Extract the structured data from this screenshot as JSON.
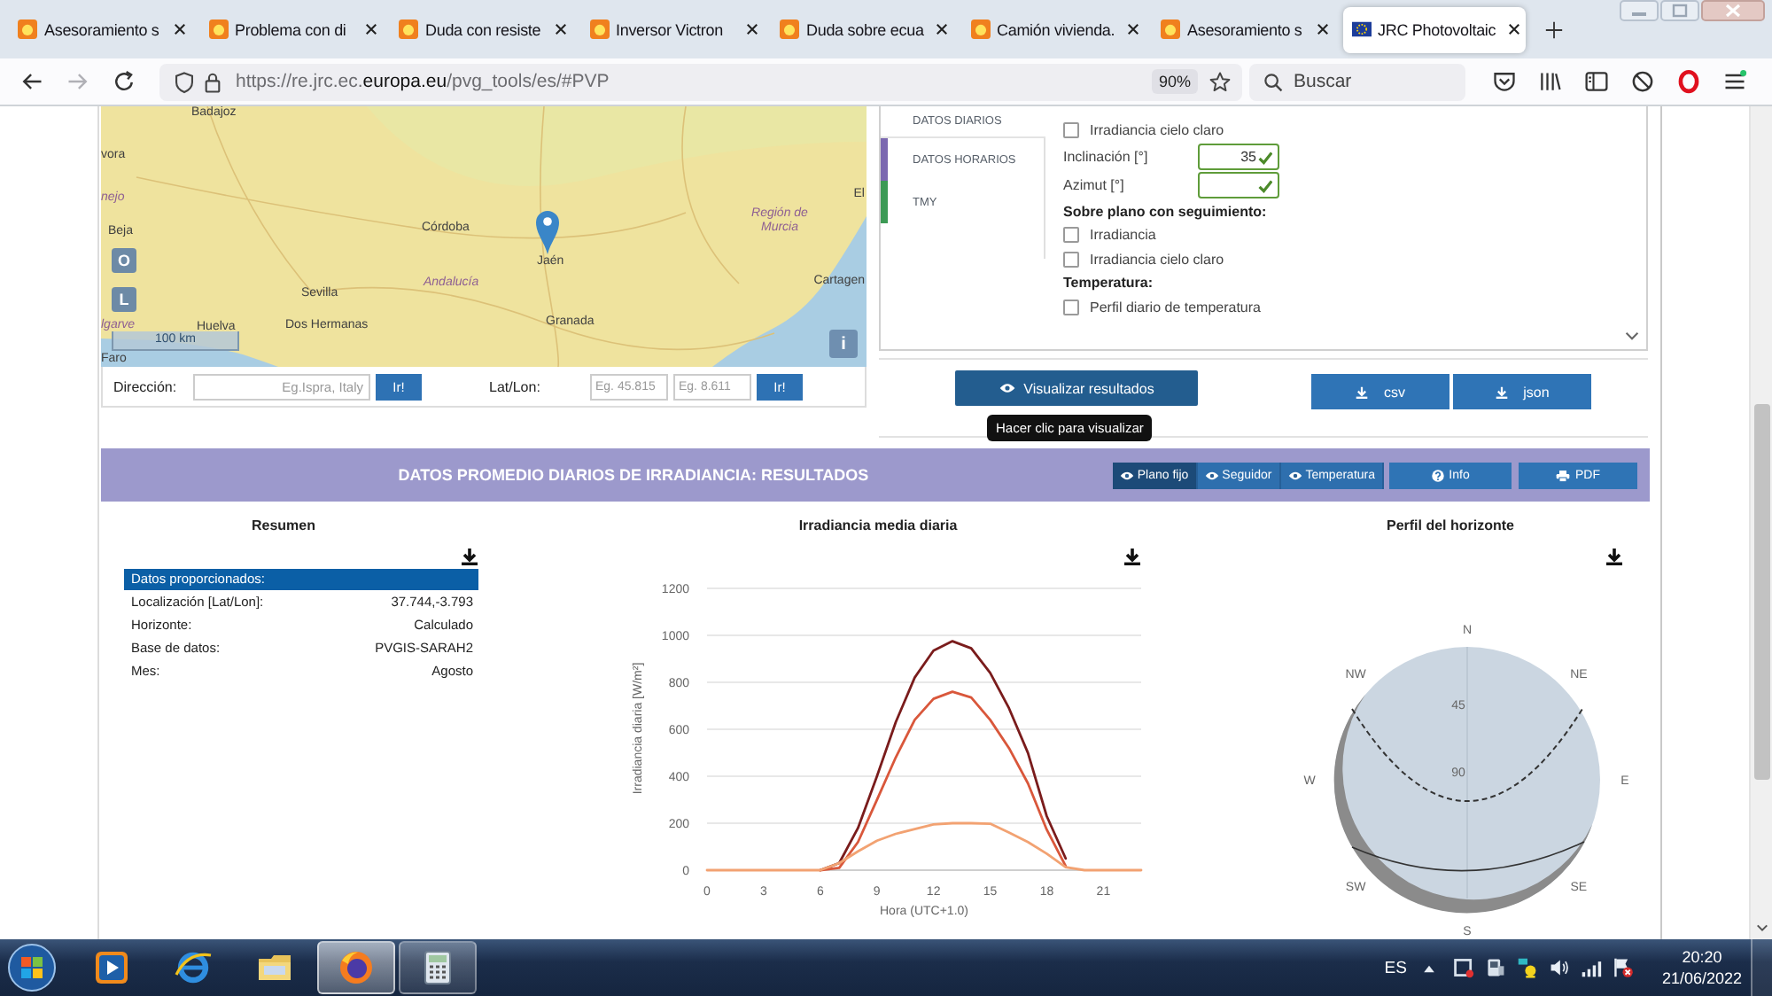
{
  "browser": {
    "tabs": [
      {
        "title": "Asesoramiento s",
        "kind": "forum",
        "selected": false
      },
      {
        "title": "Problema con di",
        "kind": "forum",
        "selected": false
      },
      {
        "title": "Duda con resiste",
        "kind": "forum",
        "selected": false
      },
      {
        "title": "Inversor Victron",
        "kind": "forum",
        "selected": false
      },
      {
        "title": "Duda sobre ecua",
        "kind": "forum",
        "selected": false
      },
      {
        "title": "Camión vivienda.",
        "kind": "forum",
        "selected": false
      },
      {
        "title": "Asesoramiento s",
        "kind": "forum",
        "selected": false
      },
      {
        "title": "JRC Photovoltaic",
        "kind": "eu",
        "selected": true
      }
    ],
    "url": {
      "start": "https://re.jrc.ec.",
      "domain": "europa.eu",
      "path": "/pvg_tools/es/#PVP"
    },
    "zoom": "90%",
    "search": {
      "placeholder": "Buscar"
    }
  },
  "map": {
    "labels": [
      {
        "text": "Badajoz",
        "kind": "city"
      },
      {
        "text": "vora",
        "kind": "city"
      },
      {
        "text": "nejo",
        "kind": "region"
      },
      {
        "text": "Beja",
        "kind": "city"
      },
      {
        "text": "Córdoba",
        "kind": "city"
      },
      {
        "text": "Jaén",
        "kind": "city"
      },
      {
        "text": "Andalucía",
        "kind": "region"
      },
      {
        "text": "Sevilla",
        "kind": "city"
      },
      {
        "text": "lgarve",
        "kind": "region"
      },
      {
        "text": "Huelva",
        "kind": "city"
      },
      {
        "text": "Dos Hermanas",
        "kind": "city"
      },
      {
        "text": "Granada",
        "kind": "city"
      },
      {
        "text": "Faro",
        "kind": "city"
      },
      {
        "text": "Región de Murcia",
        "kind": "region"
      },
      {
        "text": "Cartagen",
        "kind": "city"
      },
      {
        "text": "El",
        "kind": "city"
      }
    ],
    "layer_buttons": [
      "O",
      "L"
    ],
    "scale": "100 km",
    "info": "i"
  },
  "location": {
    "address": {
      "label": "Dirección:",
      "placeholder": "Eg.Ispra, Italy",
      "button": "Ir!"
    },
    "latlon": {
      "label": "Lat/Lon:",
      "lat_placeholder": "Eg. 45.815",
      "lon_placeholder": "Eg. 8.611",
      "button": "Ir!"
    }
  },
  "options": {
    "tabs": [
      {
        "label": "DATOS DIARIOS",
        "selected": true
      },
      {
        "label": "DATOS HORARIOS",
        "selected": false,
        "color": "#7b68b0"
      },
      {
        "label": "TMY",
        "selected": false,
        "color": "#3c9a55"
      }
    ],
    "items": [
      {
        "kind": "checkbox",
        "label": "Irradiancia cielo claro",
        "checked": false
      },
      {
        "kind": "field",
        "label": "Inclinación [°]",
        "value": "35",
        "valid": true
      },
      {
        "kind": "field",
        "label": "Azimut [°]",
        "valid": true
      },
      {
        "kind": "heading",
        "label": "Sobre plano con seguimiento:"
      },
      {
        "kind": "checkbox",
        "label": "Irradiancia",
        "checked": false
      },
      {
        "kind": "checkbox",
        "label": "Irradiancia cielo claro",
        "checked": false
      },
      {
        "kind": "heading",
        "label": "Temperatura:"
      },
      {
        "kind": "checkbox",
        "label": "Perfil diario de temperatura",
        "checked": false
      }
    ]
  },
  "actions": {
    "visualize": "Visualizar resultados",
    "tooltip": "Hacer clic para visualizar",
    "downloads": [
      "csv",
      "json"
    ]
  },
  "results": {
    "title": "DATOS PROMEDIO DIARIOS DE IRRADIANCIA: RESULTADOS",
    "views": [
      {
        "label": "Plano fijo",
        "selected": true
      },
      {
        "label": "Seguidor",
        "selected": false
      },
      {
        "label": "Temperatura",
        "selected": false
      }
    ],
    "info": "Info",
    "pdf": "PDF",
    "summary": {
      "title": "Resumen",
      "header": "Datos proporcionados:",
      "rows": [
        {
          "label": "Localización [Lat/Lon]:",
          "value": "37.744,-3.793"
        },
        {
          "label": "Horizonte:",
          "value": "Calculado"
        },
        {
          "label": "Base de datos:",
          "value": "PVGIS-SARAH2"
        },
        {
          "label": "Mes:",
          "value": "Agosto"
        }
      ]
    },
    "daily_chart": {
      "title": "Irradiancia media diaria",
      "chart_data": {
        "type": "line",
        "grid": true,
        "xlabel": "Hora (UTC+1.0)",
        "ylabel": "Irradiancia diaria [W/m²]",
        "x": [
          0,
          1,
          2,
          3,
          4,
          5,
          6,
          7,
          8,
          9,
          10,
          11,
          12,
          13,
          14,
          15,
          16,
          17,
          18,
          19,
          20,
          21,
          22,
          23
        ],
        "xlim": [
          0,
          23
        ],
        "ylim": [
          0,
          1200
        ],
        "xticks": [
          0,
          3,
          6,
          9,
          12,
          15,
          18,
          21
        ],
        "yticks": [
          0,
          200,
          400,
          600,
          800,
          1000,
          1200
        ],
        "series": [
          {
            "color": "#7a1c1c",
            "values": [
              null,
              null,
              null,
              null,
              null,
              null,
              0,
              30,
              180,
              400,
              630,
              820,
              935,
              975,
              945,
              840,
              690,
              500,
              230,
              50,
              null,
              null,
              null,
              null
            ]
          },
          {
            "color": "#d9573b",
            "values": [
              null,
              null,
              null,
              null,
              null,
              null,
              0,
              10,
              120,
              300,
              480,
              640,
              730,
              760,
              735,
              640,
              520,
              370,
              173,
              17,
              null,
              null,
              null,
              null
            ]
          },
          {
            "color": "#f2a272",
            "values": [
              0,
              0,
              0,
              0,
              0,
              0,
              0,
              30,
              80,
              125,
              155,
              175,
              195,
              200,
              200,
              198,
              160,
              120,
              70,
              13,
              0,
              0,
              0,
              0
            ]
          }
        ]
      }
    },
    "horizon": {
      "title": "Perfil del horizonte",
      "directions": [
        "N",
        "NE",
        "E",
        "SE",
        "S",
        "SW",
        "W",
        "NW"
      ],
      "rings": [
        "45",
        "90"
      ]
    }
  },
  "taskbar": {
    "apps": [
      {
        "kind": "media",
        "running": false,
        "selected": false
      },
      {
        "kind": "ie",
        "running": false,
        "selected": false
      },
      {
        "kind": "folder",
        "running": false,
        "selected": false
      },
      {
        "kind": "firefox",
        "running": true,
        "selected": true
      },
      {
        "kind": "calculator",
        "running": true,
        "selected": false
      }
    ],
    "language": "ES",
    "time": "20:20",
    "date": "21/06/2022"
  }
}
